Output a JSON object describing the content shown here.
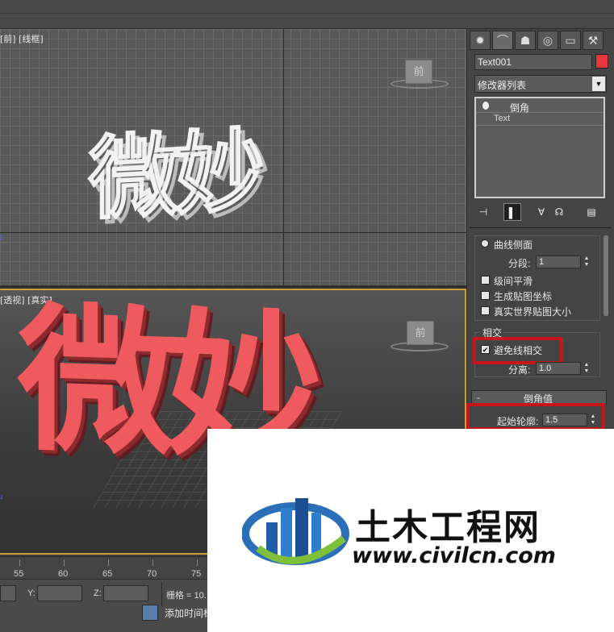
{
  "viewports": {
    "top_label": "[前] [线框]",
    "top_viewcube": "前",
    "persp_label": "[透视] [真实]",
    "persp_viewcube": "前",
    "wire_text": "微妙",
    "solid_text": "微妙"
  },
  "timeline": {
    "ticks": [
      "55",
      "60",
      "65",
      "70",
      "75"
    ]
  },
  "status": {
    "y_label": "Y:",
    "z_label": "Z:",
    "grid_label": "栅格 = 10.",
    "add_time_tag": "添加时间标"
  },
  "panel": {
    "tab_icons": [
      "sun-icon",
      "curve-icon",
      "hierarchy-icon",
      "motion-icon",
      "display-icon",
      "hammer-icon"
    ],
    "object_name": "Text001",
    "object_color": "#e8373b",
    "modifier_list_label": "修改器列表",
    "stack_items": [
      "倒角",
      "Text"
    ],
    "curve_side_label": "曲线侧面",
    "segments_label": "分段:",
    "segments_value": "1",
    "level_smooth_label": "级间平滑",
    "gen_mapping_label": "生成贴图坐标",
    "real_world_label": "真实世界贴图大小",
    "intersect_group_label": "相交",
    "avoid_intersect_label": "避免线相交",
    "avoid_intersect_checked": true,
    "separation_label": "分离:",
    "separation_value": "1.0",
    "bevel_values_header": "倒角值",
    "bevel_collapse": "-",
    "start_outline_label": "起始轮廓:",
    "start_outline_value": "1.5"
  },
  "watermark": {
    "title": "土木工程网",
    "url": "www.civilcn.com"
  }
}
